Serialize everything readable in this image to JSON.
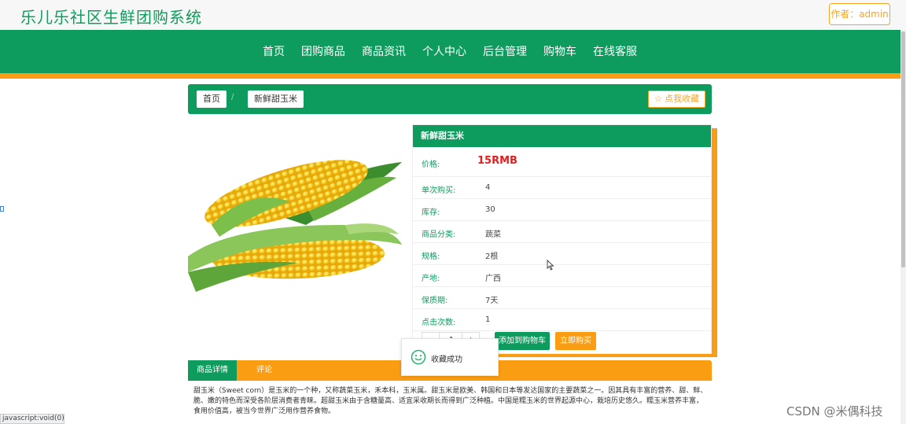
{
  "header": {
    "site_title": "乐儿乐社区生鲜团购系统",
    "author_label": "作者：admin"
  },
  "nav": {
    "items": [
      "首页",
      "团购商品",
      "商品资讯",
      "个人中心",
      "后台管理",
      "购物车",
      "在线客服"
    ]
  },
  "breadcrumb": {
    "home": "首页",
    "separator": "/",
    "current": "新鲜甜玉米",
    "favorite_label": "☆ 点我收藏"
  },
  "product": {
    "title": "新鲜甜玉米",
    "price_label": "价格:",
    "price_value": "15RMB",
    "fields": [
      {
        "label": "单次购买:",
        "value": "4"
      },
      {
        "label": "库存:",
        "value": "30"
      },
      {
        "label": "商品分类:",
        "value": "蔬菜"
      },
      {
        "label": "规格:",
        "value": "2根"
      },
      {
        "label": "产地:",
        "value": "广西"
      },
      {
        "label": "保质期:",
        "value": "7天"
      },
      {
        "label": "点击次数:",
        "value": "1"
      }
    ],
    "quantity": "1",
    "qty_minus": "-",
    "qty_plus": "+",
    "add_to_cart_label": "添加到购物车",
    "buy_now_label": "立即购买"
  },
  "tabs": {
    "details": "商品详情",
    "comments": "评论"
  },
  "description": "甜玉米（Sweet corn）是玉米的一个种，又称蔬菜玉米，禾本科，玉米属。甜玉米是欧美、韩国和日本等发达国家的主要蔬菜之一。因其具有丰富的营养、甜、鲜、脆、嫩的特色而深受各阶层消费者青睐。超甜玉米由于含糖量高、适宜采收期长而得到广泛种植。中国是糯玉米的世界起源中心，栽培历史悠久。糯玉米营养丰富，食用价值高，被当今世界广泛用作营养食物。",
  "toast": {
    "message": "收藏成功",
    "icon": "smile-icon"
  },
  "status_bar": "javascript:void(0)",
  "watermark": "CSDN @米偶科技",
  "colors": {
    "primary_green": "#0d9c5e",
    "accent_orange": "#fa9d12",
    "price_red": "#e02020"
  }
}
